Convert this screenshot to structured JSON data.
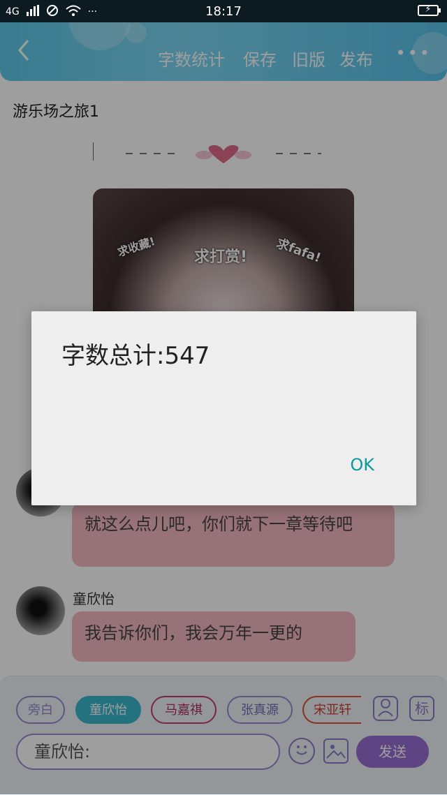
{
  "status_bar": {
    "network": "4G",
    "time": "18:17",
    "dots": "···"
  },
  "header": {
    "back_icon": "chevron-left",
    "actions": [
      "字数统计",
      "保存",
      "旧版",
      "发布"
    ],
    "more": "•••"
  },
  "story": {
    "title": "游乐场之旅1",
    "stickers": [
      "求收藏!",
      "求打赏!",
      "求fafa!"
    ]
  },
  "messages": [
    {
      "name": "",
      "text": "就这么点儿吧，你们就下一章等待吧"
    },
    {
      "name": "童欣怡",
      "text": "我告诉你们，我会万年一更的"
    }
  ],
  "bottom": {
    "characters": [
      {
        "label": "旁白",
        "border": "#9c88d2",
        "color": "#9c88d2",
        "bg": "#eef4f8"
      },
      {
        "label": "童欣怡",
        "border": "#3bb9cf",
        "color": "#ffffff",
        "bg": "#3bb9cf"
      },
      {
        "label": "马嘉祺",
        "border": "#c04070",
        "color": "#b03060",
        "bg": "#eef4f8"
      },
      {
        "label": "张真源",
        "border": "#9c88d2",
        "color": "#7a68b8",
        "bg": "#eef4f8"
      },
      {
        "label": "宋亚轩",
        "border": "#e05030",
        "color": "#d04030",
        "bg": "#eef4f8"
      }
    ],
    "person_icon": "person-icon",
    "tag_label": "标",
    "input_value": "童欣怡:",
    "send_label": "发送"
  },
  "dialog": {
    "message": "字数总计:547",
    "ok_label": "OK"
  },
  "colors": {
    "header": "#6fd0ef",
    "bubble": "#f4b9c2",
    "send": "#9a6fd3",
    "ok": "#0c9a9a"
  }
}
